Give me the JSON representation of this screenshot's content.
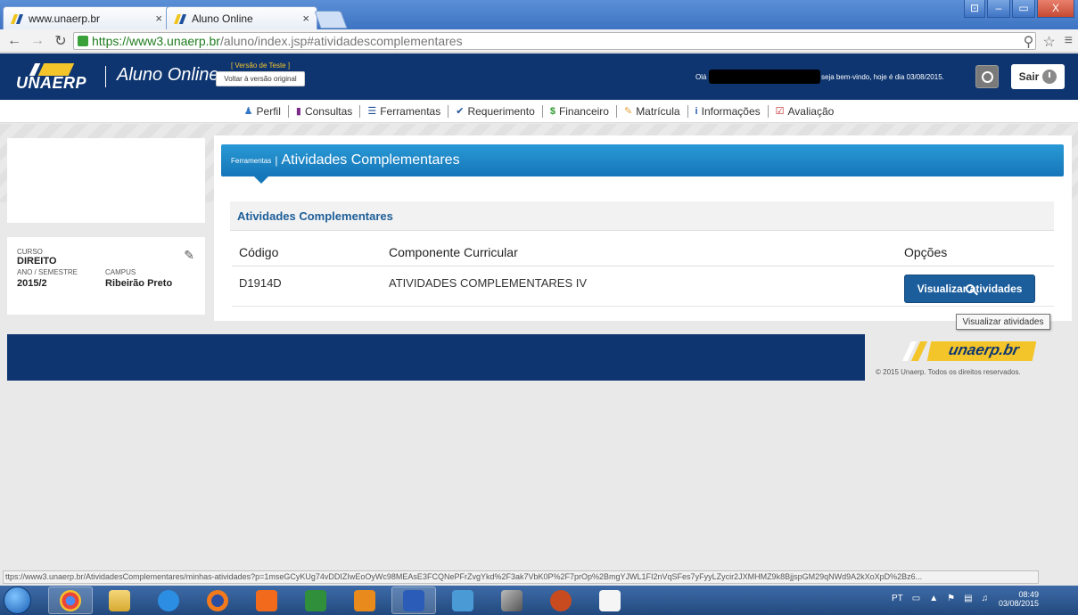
{
  "browser": {
    "tabs": [
      {
        "title": "www.unaerp.br"
      },
      {
        "title": "Aluno Online"
      }
    ],
    "url_host": "https://www3.unaerp.br",
    "url_path": "/aluno/index.jsp#atividadescomplementares",
    "status_url": "ttps://www3.unaerp.br/AtividadesComplementares/minhas-atividades?p=1mseGCyKUg74vDDIZIwEoOyWc98MEAsE3FCQNePFrZvgYkd%2F3ak7VbK0P%2F7prOp%2BmgYJWL1FI2nVqSFes7yFyyLZycir2JXMHMZ9k8BjjspGM29qNWd9A2kXoXpD%2Bz6..."
  },
  "header": {
    "logo_text": "UNAERP",
    "app_name": "Aluno Online",
    "test_version_label": "[ Versão de Teste ]",
    "back_original_button": "Voltar à versão original",
    "greeting": "Olá",
    "welcome": "seja bem-vindo, hoje é dia 03/08/2015.",
    "exit_button": "Sair"
  },
  "menu": {
    "items": [
      {
        "label": "Perfil",
        "icon": "user-icon"
      },
      {
        "label": "Consultas",
        "icon": "folder-icon"
      },
      {
        "label": "Ferramentas",
        "icon": "list-icon"
      },
      {
        "label": "Requerimento",
        "icon": "check-icon"
      },
      {
        "label": "Financeiro",
        "icon": "dollar-icon"
      },
      {
        "label": "Matrícula",
        "icon": "edit-icon"
      },
      {
        "label": "Informações",
        "icon": "info-icon"
      },
      {
        "label": "Avaliação",
        "icon": "check-square-icon"
      }
    ]
  },
  "student": {
    "course_label": "CURSO",
    "course_value": "DIREITO",
    "year_label": "ANO / SEMESTRE",
    "year_value": "2015/2",
    "campus_label": "CAMPUS",
    "campus_value": "Ribeirão Preto"
  },
  "panel": {
    "breadcrumb": "Ferramentas",
    "separator": "|",
    "title": "Atividades Complementares",
    "subheading": "Atividades Complementares",
    "columns": [
      "Código",
      "Componente Curricular",
      "Opções"
    ],
    "rows": [
      {
        "code": "D1914D",
        "component": "ATIVIDADES COMPLEMENTARES IV",
        "action": "Visualizar atividades"
      }
    ],
    "tooltip": "Visualizar atividades"
  },
  "footer": {
    "logo_text": "unaerp.br",
    "copyright": "© 2015 Unaerp. Todos os direitos reservados."
  },
  "taskbar": {
    "lang": "PT",
    "time": "08:49",
    "date": "03/08/2015"
  }
}
